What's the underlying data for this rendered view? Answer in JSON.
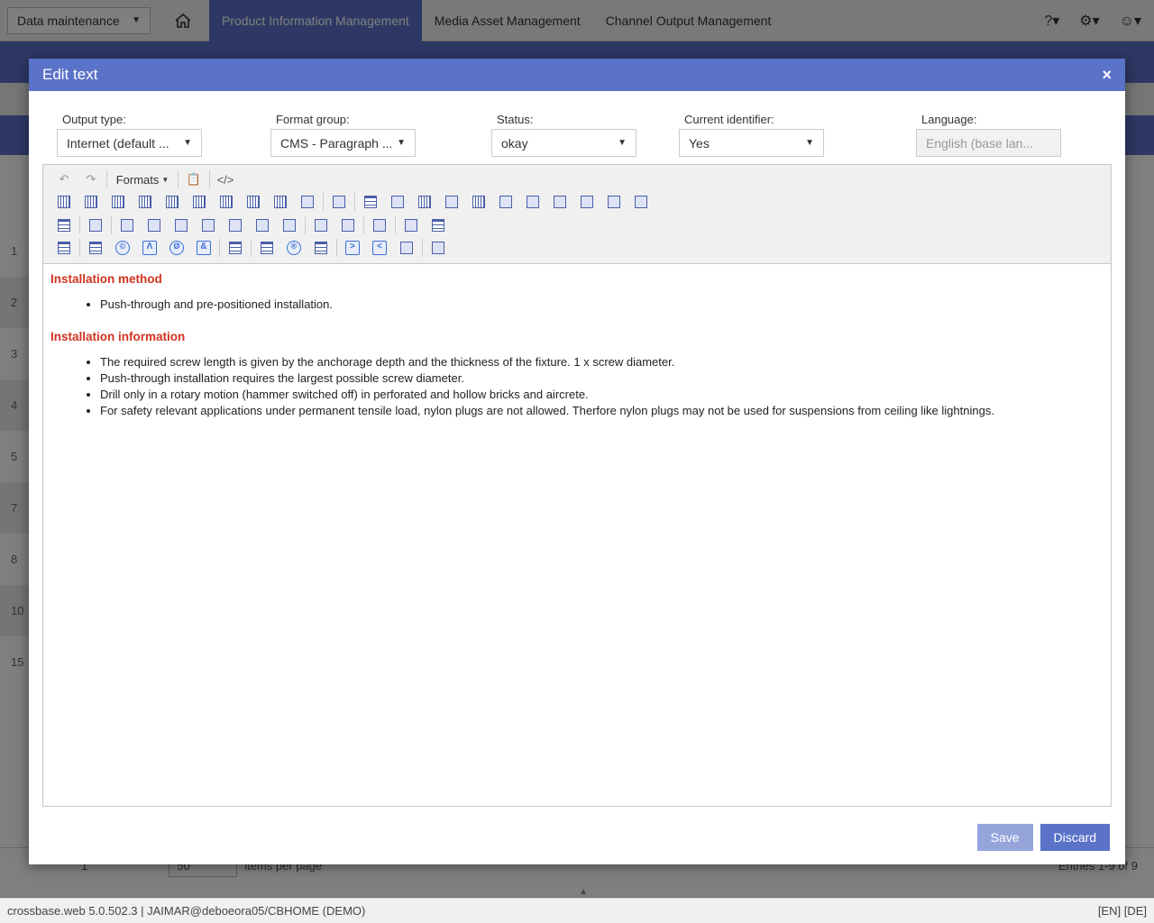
{
  "app": {
    "area_select": "Data maintenance",
    "nav": [
      "Product Information Management",
      "Media Asset Management",
      "Channel Output Management"
    ],
    "row_numbers": [
      "1",
      "2",
      "3",
      "4",
      "5",
      "7",
      "8",
      "10",
      "15"
    ],
    "pager": {
      "page": "1",
      "per_page": "50",
      "per_page_label": "items per page",
      "entries": "Entries 1-9 of 9"
    },
    "status_left": "crossbase.web 5.0.502.3 | JAIMAR@deboeora05/CBHOME (DEMO)",
    "status_right": "[EN] [DE]"
  },
  "modal": {
    "title": "Edit text",
    "close_symbol": "×",
    "fields": {
      "output_type": {
        "label": "Output type:",
        "value": "Internet (default ..."
      },
      "format_group": {
        "label": "Format group:",
        "value": "CMS - Paragraph ..."
      },
      "status": {
        "label": "Status:",
        "value": "okay"
      },
      "current_identifier": {
        "label": "Current identifier:",
        "value": "Yes"
      },
      "language": {
        "label": "Language:",
        "value": "English (base lan..."
      }
    },
    "toolbar": {
      "formats_label": "Formats",
      "source_code_symbol": "</>",
      "row3_letter_icons": [
        "©",
        "Λ",
        "Ø",
        "&"
      ],
      "row4_letter_icons": [
        "®",
        ">",
        "<"
      ]
    },
    "content": {
      "section1_heading": "Installation method",
      "section1_items": [
        "Push-through and pre-positioned installation."
      ],
      "section2_heading": "Installation information",
      "section2_items": [
        "The required screw length is given by the anchorage depth and the thickness of the fixture. 1 x screw diameter.",
        "Push-through installation requires the largest possible screw diameter.",
        "Drill only in a rotary motion (hammer switched off) in perforated and hollow bricks and aircrete.",
        "For safety relevant applications under permanent tensile load, nylon plugs are not allowed. Therfore nylon plugs may not be used for suspensions from ceiling like lightnings."
      ]
    },
    "buttons": {
      "save": "Save",
      "discard": "Discard"
    }
  },
  "colors": {
    "accent": "#5a72c8",
    "heading_red": "#d0331f",
    "save_disabled": "#95a5dc"
  }
}
